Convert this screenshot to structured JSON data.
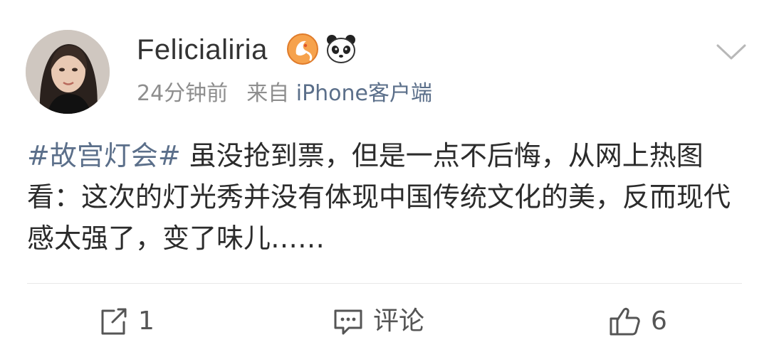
{
  "post": {
    "username": "Felicialiria",
    "time": "24分钟前",
    "source_prefix": "来自",
    "source_client": "iPhone客户端",
    "hashtag": "#故宫灯会#",
    "text": "虽没抢到票，但是一点不后悔，从网上热图看：这次的灯光秀并没有体现中国传统文化的美，反而现代感太强了，变了味儿……"
  },
  "actions": {
    "repost_count": "1",
    "comment_label": "评论",
    "like_count": "6"
  },
  "icons": {
    "badge_1": "fox-badge-icon",
    "badge_2": "panda-badge-icon",
    "menu": "chevron-down-icon",
    "repost": "share-icon",
    "comment": "comment-icon",
    "like": "thumbs-up-icon"
  },
  "colors": {
    "link": "#5b6f8a",
    "meta": "#8e8e8e",
    "text": "#2b2b2b"
  }
}
